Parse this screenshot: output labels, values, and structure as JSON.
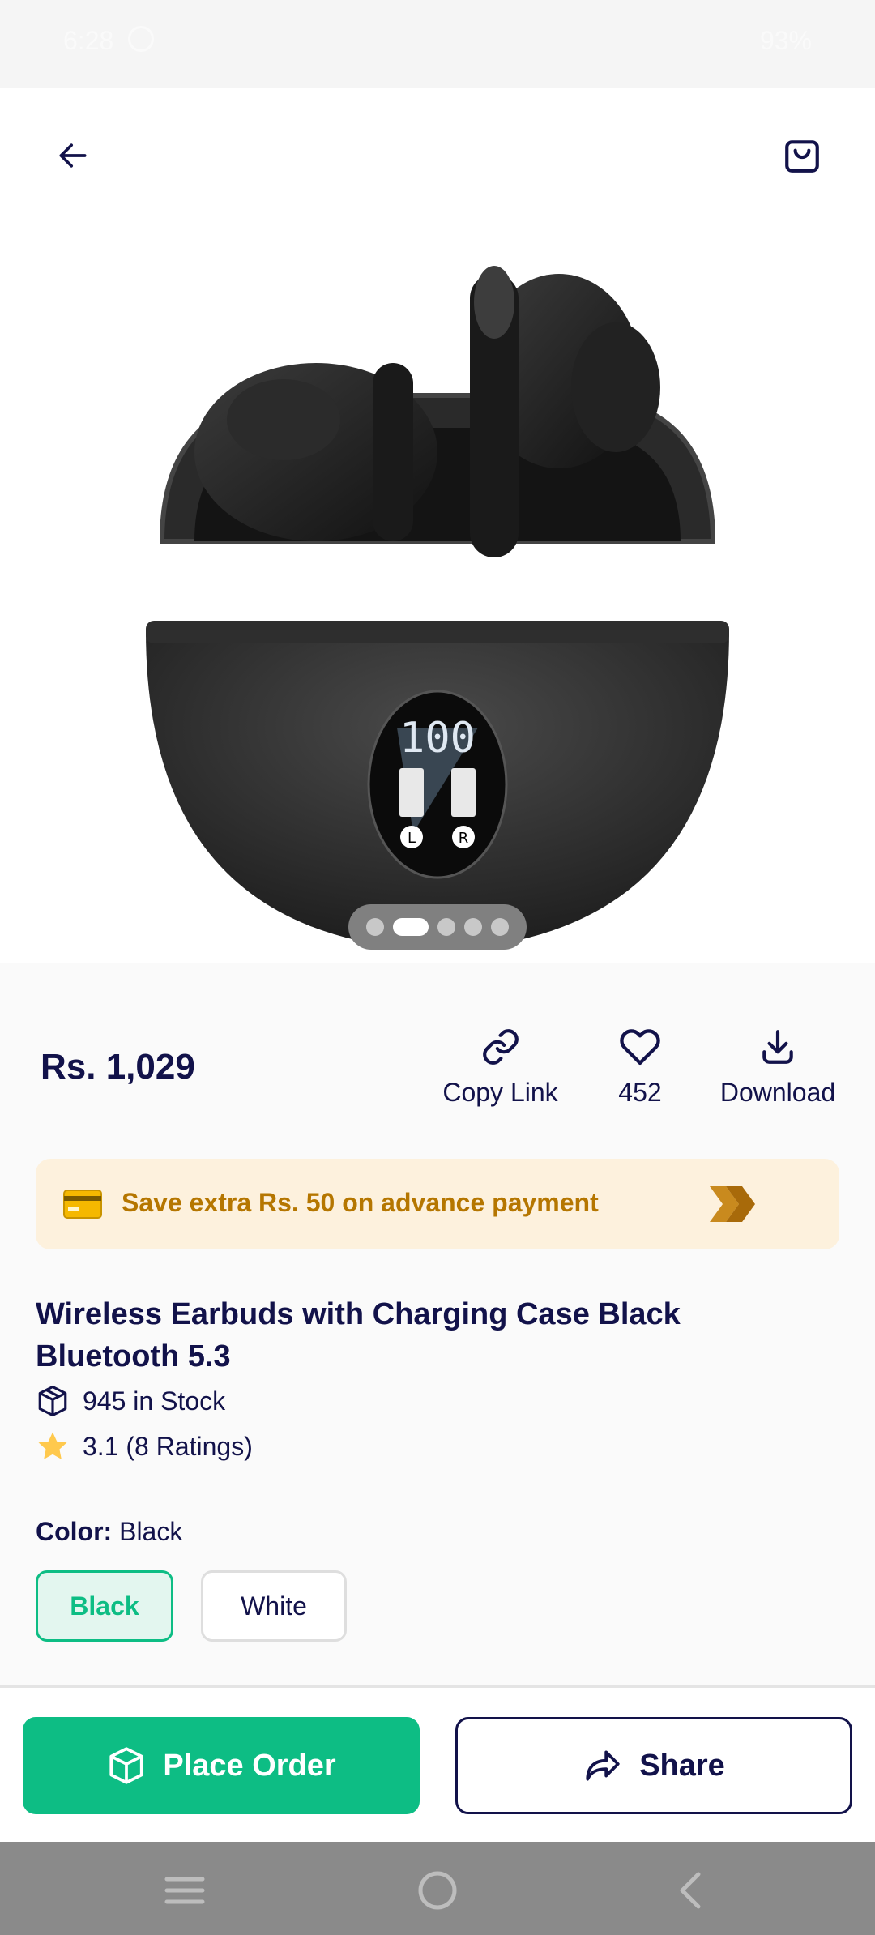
{
  "status_bar": {
    "time": "6:28",
    "right_text": "93%"
  },
  "gallery": {
    "pages": 5,
    "active_page": 2
  },
  "product": {
    "price": "Rs. 1,029",
    "title": "Wireless Earbuds with Charging Case Black Bluetooth 5.3",
    "stock": "945 in Stock",
    "rating": "3.1 (8 Ratings)",
    "color_label": "Color:",
    "color_value": "Black",
    "colors": [
      "Black",
      "White"
    ],
    "selected_color": "Black"
  },
  "actions": {
    "copy_link": "Copy Link",
    "likes": "452",
    "download": "Download"
  },
  "promo": {
    "text": "Save extra Rs. 50 on advance payment"
  },
  "buttons": {
    "place_order": "Place Order",
    "share": "Share"
  },
  "colors": {
    "accent": "#0dbd84",
    "navy": "#12124a",
    "promo_bg": "#fdf1dd",
    "promo_text": "#b57600"
  },
  "icons": [
    "back-arrow-icon",
    "shopping-bag-icon",
    "link-icon",
    "heart-icon",
    "download-icon",
    "credit-card-icon",
    "double-chevron-icon",
    "box-icon",
    "star-icon",
    "cube-icon",
    "share-icon",
    "menu-icon",
    "home-icon",
    "back-nav-icon"
  ]
}
